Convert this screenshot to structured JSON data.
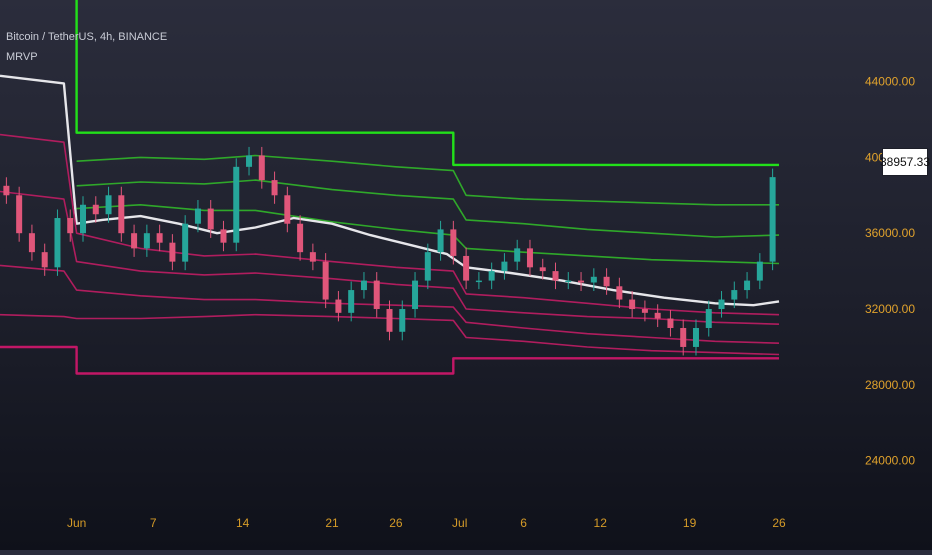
{
  "header": {
    "symbol_line": "Bitcoin / TetherUS, 4h, BINANCE",
    "indicator_label": "MRVP"
  },
  "last_price_label": "38957.33",
  "colors": {
    "background_top": "#2b2d3c",
    "background_bottom": "#0f111a",
    "axis_text": "#e0a22c",
    "band_outer_top": "#22e01a",
    "band_green": "#2fa82a",
    "vwap_line": "#e6e6ea",
    "band_pink": "#b01d5e",
    "band_outer_bottom": "#c21766",
    "candle_up": "#26a69a",
    "candle_down": "#e0567a"
  },
  "chart_data": {
    "type": "line",
    "title": "Bitcoin / TetherUS, 4h, BINANCE",
    "indicator": "MRVP",
    "timeframe": "4h",
    "y_axis_ticks": [
      "44000.00",
      "40000.00",
      "36000.00",
      "32000.00",
      "28000.00",
      "24000.00"
    ],
    "y_tick_values": [
      44000,
      40000,
      36000,
      32000,
      28000,
      24000
    ],
    "ylim": [
      21400,
      48300
    ],
    "x_axis_ticks": [
      "Jun",
      "7",
      "14",
      "21",
      "26",
      "Jul",
      "6",
      "12",
      "19",
      "26"
    ],
    "x_tick_days": [
      0,
      6,
      13,
      20,
      25,
      30,
      35,
      41,
      48,
      55
    ],
    "xlim_days": [
      -6,
      61.5
    ],
    "last_price": 38957.33,
    "price_series": {
      "name": "BTCUSDT",
      "x_days": [
        -6,
        -5,
        -4,
        -3,
        -2,
        -1,
        0,
        1,
        2,
        3,
        4,
        5,
        6,
        7,
        8,
        9,
        10,
        11,
        12,
        13,
        14,
        15,
        16,
        17,
        18,
        19,
        20,
        21,
        22,
        23,
        24,
        25,
        26,
        27,
        28,
        29,
        30,
        31,
        32,
        33,
        34,
        35,
        36,
        37,
        38,
        39,
        40,
        41,
        42,
        43,
        44,
        45,
        46,
        47,
        48,
        49,
        50,
        51,
        52,
        53,
        54,
        55
      ],
      "close": [
        38500,
        38000,
        36000,
        35000,
        34200,
        36800,
        36000,
        37500,
        37000,
        38000,
        36000,
        35200,
        36000,
        35500,
        34500,
        36500,
        37300,
        36200,
        35500,
        39500,
        40100,
        38800,
        38000,
        36500,
        35000,
        34500,
        32500,
        31800,
        33000,
        33500,
        32000,
        30800,
        32000,
        33500,
        35000,
        36200,
        34800,
        33500,
        33500,
        34000,
        34500,
        35200,
        34200,
        34000,
        33500,
        33500,
        33400,
        33700,
        33200,
        32500,
        32000,
        31800,
        31500,
        31000,
        30000,
        31000,
        32000,
        32500,
        33000,
        33500,
        34500,
        38957.33
      ]
    },
    "series": [
      {
        "name": "upper_band_4",
        "segments": [
          {
            "x_days": [
              -6,
              0
            ],
            "values": [
              48600,
              48600
            ]
          },
          {
            "x_days": [
              0,
              29.5
            ],
            "values": [
              41300,
              41300
            ]
          },
          {
            "x_days": [
              29.5,
              55
            ],
            "values": [
              39600,
              39600
            ]
          }
        ]
      },
      {
        "name": "upper_band_3",
        "x_days": [
          0,
          5,
          10,
          14,
          20,
          25,
          29.5,
          30.5,
          35,
          40,
          45,
          50,
          55
        ],
        "values": [
          39800,
          40000,
          39900,
          40100,
          39800,
          39500,
          39300,
          38000,
          37800,
          37700,
          37600,
          37500,
          37500
        ]
      },
      {
        "name": "upper_band_2",
        "x_days": [
          0,
          5,
          10,
          14,
          20,
          25,
          29.5,
          30.5,
          35,
          40,
          45,
          50,
          55
        ],
        "values": [
          38500,
          38700,
          38600,
          38800,
          38300,
          38000,
          37800,
          36700,
          36500,
          36200,
          36000,
          35800,
          35900
        ]
      },
      {
        "name": "upper_band_1",
        "x_days": [
          0,
          5,
          10,
          14,
          20,
          25,
          29.5,
          30.5,
          35,
          40,
          45,
          50,
          55
        ],
        "values": [
          37300,
          37500,
          37200,
          37200,
          36600,
          36200,
          35900,
          35200,
          35000,
          34800,
          34600,
          34500,
          34400
        ]
      },
      {
        "name": "vwap",
        "x_days": [
          -6,
          -1,
          0,
          2,
          5,
          8,
          11,
          14,
          17,
          20,
          23,
          26,
          29,
          30.5,
          34,
          38,
          42,
          46,
          50,
          53,
          55
        ],
        "values": [
          44300,
          43900,
          36500,
          36700,
          36900,
          36500,
          36000,
          36300,
          36800,
          36500,
          35900,
          35400,
          34900,
          34200,
          33900,
          33500,
          33000,
          32600,
          32300,
          32200,
          32400
        ]
      },
      {
        "name": "lower_band_1",
        "x_days": [
          -6,
          -1,
          0,
          5,
          10,
          14,
          20,
          25,
          29.5,
          30.5,
          35,
          40,
          45,
          50,
          55
        ],
        "values": [
          41200,
          40800,
          36000,
          35200,
          34800,
          34900,
          34500,
          34200,
          34000,
          32800,
          32600,
          32300,
          32000,
          31800,
          31700
        ]
      },
      {
        "name": "lower_band_2",
        "x_days": [
          -6,
          -1,
          0,
          5,
          10,
          14,
          20,
          25,
          29.5,
          30.5,
          35,
          40,
          45,
          50,
          55
        ],
        "values": [
          38200,
          37800,
          34500,
          34000,
          33800,
          33900,
          33600,
          33300,
          33100,
          32000,
          31800,
          31600,
          31500,
          31300,
          31200
        ]
      },
      {
        "name": "lower_band_3",
        "x_days": [
          -6,
          -1,
          0,
          5,
          10,
          14,
          20,
          25,
          29.5,
          30.5,
          35,
          40,
          45,
          50,
          55
        ],
        "values": [
          34300,
          34000,
          33000,
          32700,
          32500,
          32500,
          32300,
          32200,
          32100,
          31300,
          31000,
          30700,
          30500,
          30300,
          30200
        ]
      },
      {
        "name": "lower_band_4",
        "x_days": [
          -6,
          -1,
          0,
          5,
          10,
          14,
          20,
          25,
          29.5,
          30.5,
          35,
          40,
          45,
          50,
          55
        ],
        "values": [
          31700,
          31600,
          31500,
          31500,
          31600,
          31700,
          31600,
          31500,
          31400,
          30500,
          30300,
          30000,
          29800,
          29700,
          29600
        ]
      },
      {
        "name": "lower_band_5",
        "segments": [
          {
            "x_days": [
              -6,
              0
            ],
            "values": [
              30000,
              30000
            ]
          },
          {
            "x_days": [
              0,
              29.5
            ],
            "values": [
              28600,
              28600
            ]
          },
          {
            "x_days": [
              29.5,
              55
            ],
            "values": [
              29400,
              29400
            ]
          }
        ]
      }
    ],
    "grid": false,
    "legend": "none"
  }
}
